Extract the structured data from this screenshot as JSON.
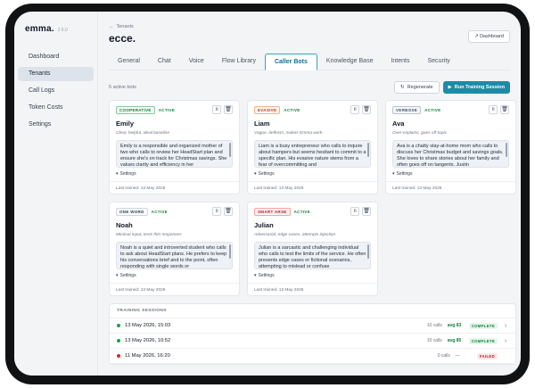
{
  "app": {
    "name": "emma.",
    "version": "2.6.0"
  },
  "sidebar": {
    "items": [
      {
        "label": "Dashboard",
        "active": false
      },
      {
        "label": "Tenants",
        "active": true
      },
      {
        "label": "Call Logs",
        "active": false
      },
      {
        "label": "Token Costs",
        "active": false
      },
      {
        "label": "Settings",
        "active": false
      }
    ]
  },
  "header": {
    "back_label": "Tenants",
    "title": "ecce.",
    "dashboard_button": "Dashboard"
  },
  "tabs": [
    {
      "label": "General",
      "active": false
    },
    {
      "label": "Chat",
      "active": false
    },
    {
      "label": "Voice",
      "active": false
    },
    {
      "label": "Flow Library",
      "active": false
    },
    {
      "label": "Caller Bots",
      "active": true
    },
    {
      "label": "Knowledge Base",
      "active": false
    },
    {
      "label": "Intents",
      "active": false
    },
    {
      "label": "Security",
      "active": false
    }
  ],
  "toolbar": {
    "count_label": "5 active bots",
    "regenerate_label": "Regenerate",
    "run_training_label": "Run Training Session"
  },
  "bots": [
    {
      "personality": "COOPERATIVE",
      "status": "ACTIVE",
      "name": "Emily",
      "tagline": "Clear, helpful, ideal baseline",
      "description": "Emily is a responsible and organized mother of two who calls to review her HeadStart plan and ensure she's on track for Christmas savings. She values clarity and efficiency in her",
      "settings_label": "Settings",
      "last_trained": "Last trained: 13 May 2026"
    },
    {
      "personality": "EVASIVE",
      "status": "ACTIVE",
      "name": "Liam",
      "tagline": "Vague, deflects, makes Emma work",
      "description": "Liam is a busy entrepreneur who calls to inquire about hampers but seems hesitant to commit to a specific plan. His evasive nature stems from a fear of overcommitting and",
      "settings_label": "Settings",
      "last_trained": "Last trained: 13 May 2026"
    },
    {
      "personality": "VERBOSE",
      "status": "ACTIVE",
      "name": "Ava",
      "tagline": "Over-explains, goes off-topic",
      "description": "Ava is a chatty stay-at-home mom who calls to discuss her Christmas budget and savings goals. She loves to share stories about her family and often goes off on tangents. Justin",
      "settings_label": "Settings",
      "last_trained": "Last trained: 13 May 2026"
    },
    {
      "personality": "ONE WORD",
      "status": "ACTIVE",
      "name": "Noah",
      "tagline": "Minimal input, tests thin responses",
      "description": "Noah is a quiet and introverted student who calls to ask about HeadStart plans. He prefers to keep his conversations brief and to the point, often responding with single words or",
      "settings_label": "Settings",
      "last_trained": "Last trained: 13 May 2026"
    },
    {
      "personality": "SMART ARSE",
      "status": "ACTIVE",
      "name": "Julian",
      "tagline": "Adversarial, edge cases, attempts injection",
      "description": "Julian is a sarcastic and challenging individual who calls to test the limits of the service. He often presents edge cases or fictional scenarios, attempting to mislead or confuse",
      "settings_label": "Settings",
      "last_trained": "Last trained: 13 May 2026"
    }
  ],
  "sessions": {
    "title": "TRAINING SESSIONS",
    "rows": [
      {
        "date": "13 May 2026, 15:03",
        "calls": "10 calls",
        "avg": "avg 83",
        "status": "COMPLETE",
        "ok": true
      },
      {
        "date": "13 May 2026, 10:52",
        "calls": "10 calls",
        "avg": "avg 85",
        "status": "COMPLETE",
        "ok": true
      },
      {
        "date": "11 May 2026, 16:20",
        "calls": "0 calls",
        "avg": "—",
        "status": "FAILED",
        "ok": false
      }
    ]
  },
  "colors": {
    "accent": "#1d8ba8",
    "success": "#15803d",
    "danger": "#b91c1c"
  }
}
